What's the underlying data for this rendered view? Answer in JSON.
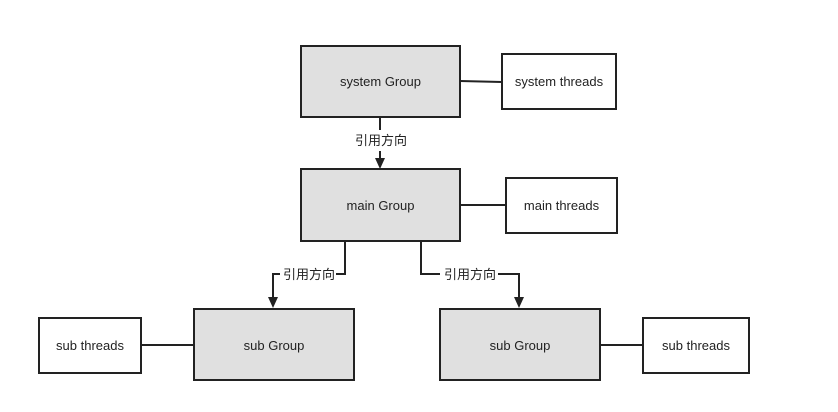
{
  "nodes": {
    "system_group": "system Group",
    "system_threads": "system threads",
    "main_group": "main Group",
    "main_threads": "main threads",
    "sub_group_left": "sub Group",
    "sub_threads_left": "sub threads",
    "sub_group_right": "sub Group",
    "sub_threads_right": "sub threads"
  },
  "edge_labels": {
    "system_to_main": "引用方向",
    "main_to_sub_left": "引用方向",
    "main_to_sub_right": "引用方向"
  },
  "colors": {
    "group_fill": "#e0e0e0",
    "thread_fill": "#ffffff",
    "stroke": "#222222"
  }
}
